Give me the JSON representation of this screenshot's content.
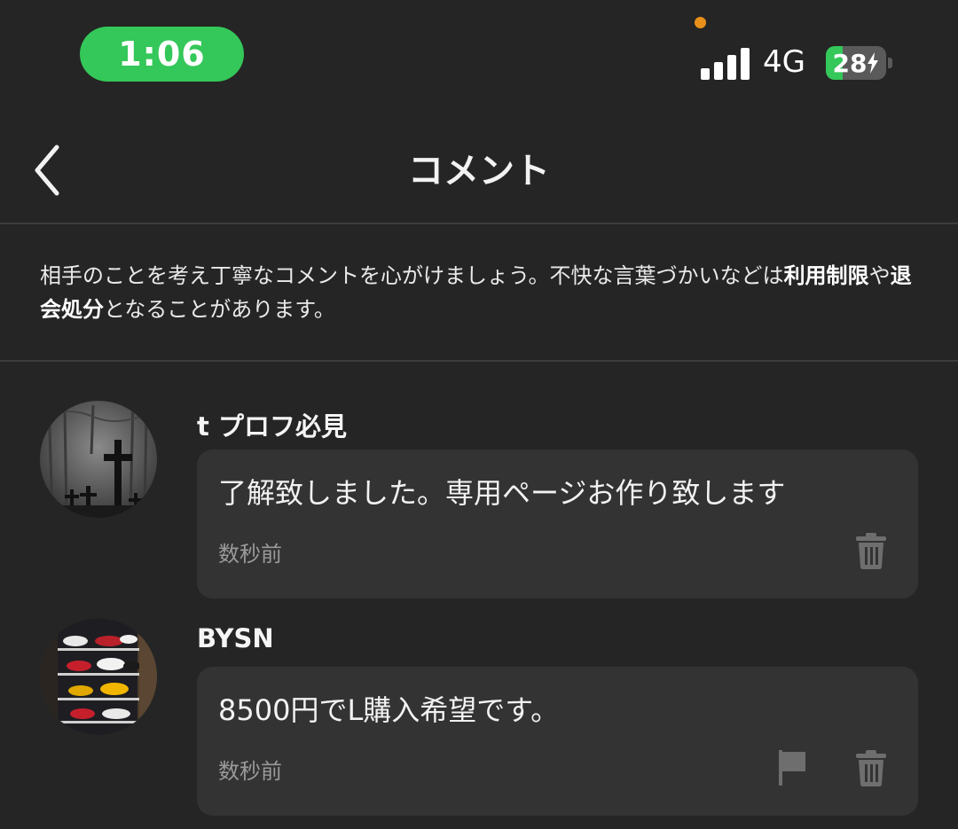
{
  "status_bar": {
    "time": "1:06",
    "network": "4G",
    "battery": "28"
  },
  "nav": {
    "title": "コメント"
  },
  "notice": {
    "text_before": "相手のことを考え丁寧なコメントを心がけましょう。不快な言葉づかいなどは",
    "bold1": "利用制限",
    "text_mid": "や",
    "bold2": "退会処分",
    "text_after": "となることがあります。"
  },
  "comments": [
    {
      "username": "t プロフ必見",
      "text": "了解致しました。専用ページお作り致します",
      "time": "数秒前",
      "actions": [
        "trash-icon"
      ]
    },
    {
      "username": "BYSN",
      "text": "8500円でL購入希望です。",
      "time": "数秒前",
      "actions": [
        "flag-icon",
        "trash-icon"
      ]
    }
  ],
  "colors": {
    "background": "#252525",
    "bubble": "#333333",
    "time_pill": "#34c759",
    "camera_dot": "#e8901a"
  }
}
